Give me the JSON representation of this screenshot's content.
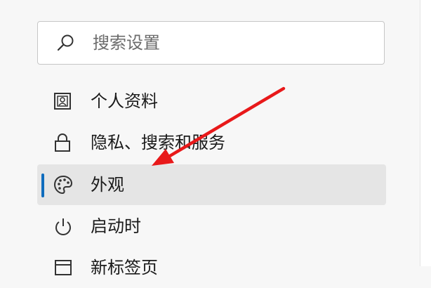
{
  "search": {
    "placeholder": "搜索设置",
    "icon": "search-icon"
  },
  "sidebar": {
    "accent_color": "#0f6cbd",
    "selected_background": "#e5e5e5",
    "items": [
      {
        "label": "个人资料",
        "icon": "profile-icon",
        "selected": false
      },
      {
        "label": "隐私、搜索和服务",
        "icon": "lock-icon",
        "selected": false
      },
      {
        "label": "外观",
        "icon": "palette-icon",
        "selected": true
      },
      {
        "label": "启动时",
        "icon": "power-icon",
        "selected": false
      },
      {
        "label": "新标签页",
        "icon": "new-tab-icon",
        "selected": false
      }
    ]
  },
  "annotation": {
    "type": "arrow",
    "color": "#e8191a",
    "points_to": "外观"
  }
}
